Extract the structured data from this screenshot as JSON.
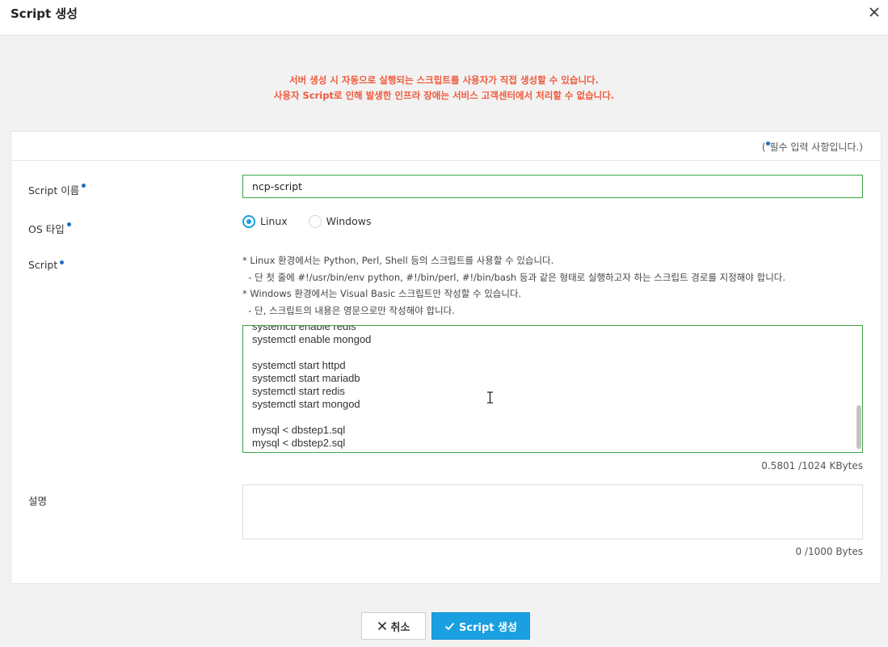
{
  "header": {
    "title": "Script 생성"
  },
  "notice": {
    "line1": "서버 생성 시 자동으로 실행되는 스크립트를 사용자가 직접 생성할 수 있습니다.",
    "line2": "사용자 Script로 인해 발생한 인프라 장애는 서비스 고객센터에서 처리할 수 없습니다."
  },
  "form": {
    "required_prefix": "(",
    "required_text": "필수 입력 사항입니다.)",
    "name_label": "Script 이름",
    "name_value": "ncp-script",
    "os_label": "OS 타입",
    "os_options": [
      {
        "label": "Linux",
        "checked": true
      },
      {
        "label": "Windows",
        "checked": false
      }
    ],
    "script_label": "Script",
    "help_text": "* Linux 환경에서는 Python, Perl, Shell 등의 스크립트를 사용할 수 있습니다.\n  - 단 첫 줄에 #!/usr/bin/env python, #!/bin/perl, #!/bin/bash 등과 같은 형태로 실행하고자 하는 스크립트 경로를 지정해야 합니다.\n* Windows 환경에서는 Visual Basic 스크립트만 작성할 수 있습니다.\n  - 단, 스크립트의 내용은 영문으로만 작성해야 합니다.",
    "script_text": "systemctl enable redis\nsystemctl enable mongod\n\nsystemctl start httpd\nsystemctl start mariadb\nsystemctl start redis\nsystemctl start mongod\n\nmysql < dbstep1.sql\nmysql < dbstep2.sql",
    "script_size": "0.5801 /1024 KBytes",
    "desc_label": "설명",
    "desc_value": "",
    "desc_count": "0 /1000 Bytes"
  },
  "buttons": {
    "cancel": "취소",
    "create": "Script 생성"
  },
  "colors": {
    "accent": "#1a9fe0",
    "notice": "#f05a3c",
    "input_border_active": "#3aa344"
  }
}
